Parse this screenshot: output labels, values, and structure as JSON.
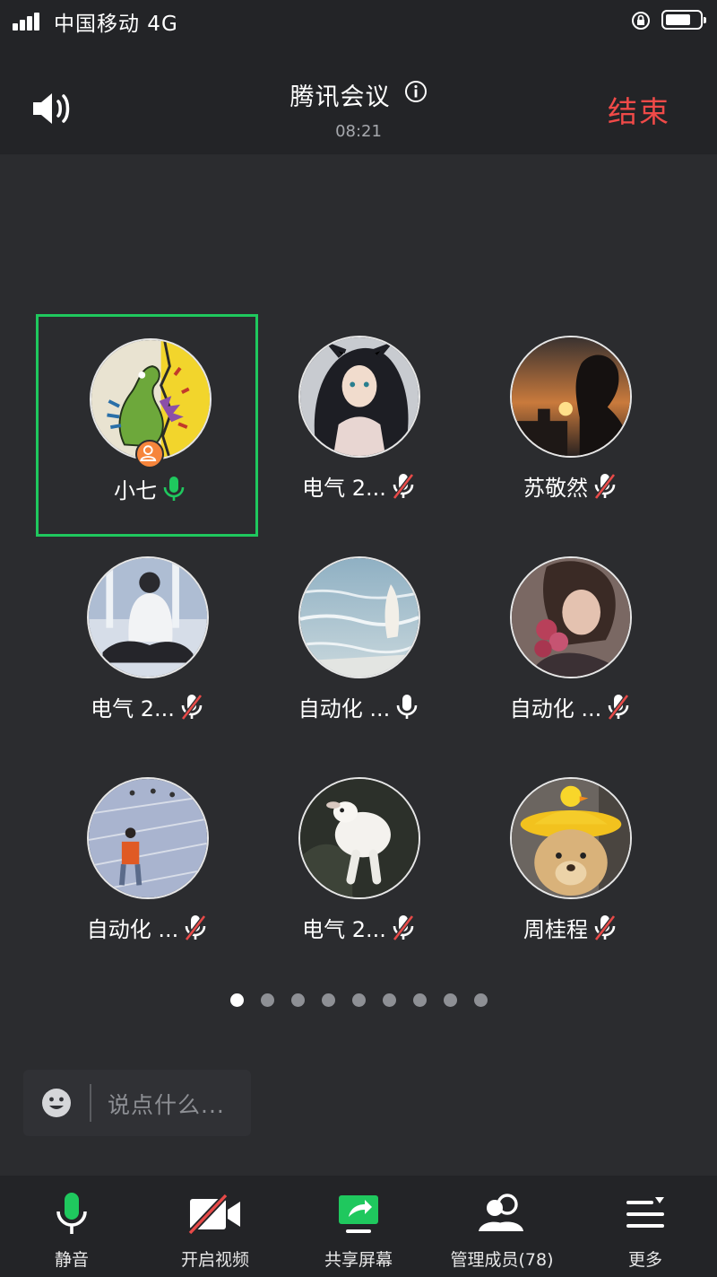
{
  "status_bar": {
    "carrier": "中国移动  4G",
    "battery_level": 0.75
  },
  "header": {
    "title": "腾讯会议",
    "duration": "08:21",
    "end_label": "结束",
    "end_color": "#f04a48"
  },
  "participants": [
    {
      "name": "小七",
      "mic": "speaking",
      "host": true,
      "active": true,
      "avatar": "dinosaur-drawing"
    },
    {
      "name": "电气 2...",
      "mic": "muted",
      "avatar": "anime-girl"
    },
    {
      "name": "苏敬然",
      "mic": "muted",
      "avatar": "sunset-silhouette"
    },
    {
      "name": "电气 2...",
      "mic": "muted",
      "avatar": "man-sitting"
    },
    {
      "name": "自动化 ...",
      "mic": "on",
      "avatar": "ocean-shore"
    },
    {
      "name": "自动化 ...",
      "mic": "muted",
      "avatar": "roses-portrait"
    },
    {
      "name": "自动化 ...",
      "mic": "muted",
      "avatar": "running-track"
    },
    {
      "name": "电气 2...",
      "mic": "muted",
      "avatar": "white-lamb"
    },
    {
      "name": "周桂程",
      "mic": "muted",
      "avatar": "teddy-duck-hat"
    }
  ],
  "pagination": {
    "total": 9,
    "current": 1
  },
  "chat": {
    "placeholder": "说点什么..."
  },
  "toolbar": {
    "mute": "静音",
    "video": "开启视频",
    "share": "共享屏幕",
    "members": "管理成员(78)",
    "more": "更多"
  },
  "colors": {
    "accent_green": "#1fc85e",
    "muted_red": "#e84a48",
    "background": "#2b2c2f"
  }
}
